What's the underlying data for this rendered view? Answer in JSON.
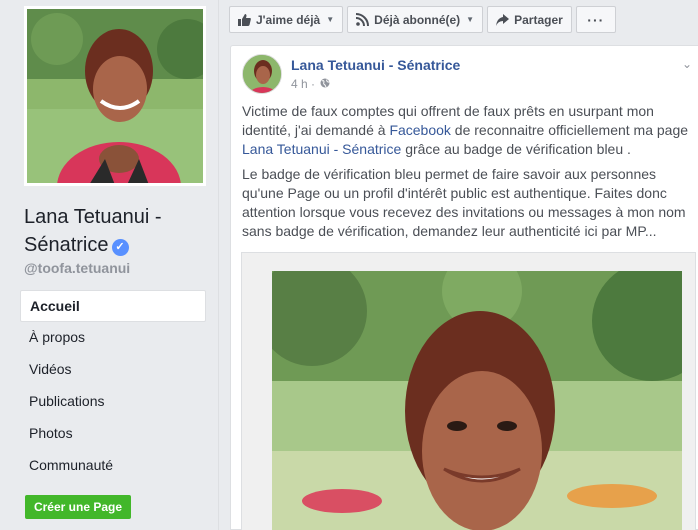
{
  "left": {
    "name_line1": "Lana Tetuanui -",
    "name_line2": "Sénatrice",
    "handle": "@toofa.tetuanui",
    "nav": [
      {
        "label": "Accueil"
      },
      {
        "label": "À propos"
      },
      {
        "label": "Vidéos"
      },
      {
        "label": "Publications"
      },
      {
        "label": "Photos"
      },
      {
        "label": "Communauté"
      }
    ],
    "create_page": "Créer une Page"
  },
  "actions": {
    "like": "J'aime déjà",
    "follow": "Déjà abonné(e)",
    "share": "Partager",
    "more": "···"
  },
  "post": {
    "author": "Lana Tetuanui - Sénatrice",
    "time": "4 h ·",
    "p1_a": "Victime de faux comptes qui offrent de faux prêts en usurpant mon identité, j'ai demandé à ",
    "p1_link1": "Facebook",
    "p1_b": " de reconnaitre officiellement ma page ",
    "p1_link2": "Lana Tetuanui - Sénatrice",
    "p1_c": " grâce au badge de vérification bleu .",
    "p2": "Le badge de vérification bleu permet de faire savoir aux personnes qu'une Page ou un profil d'intérêt public est authentique. Faites donc attention lorsque vous recevez des invitations ou messages à mon nom sans badge de vérification, demandez leur authenticité ici par MP..."
  },
  "colors": {
    "link": "#365899",
    "verified": "#5890ff",
    "create_button": "#42b72a",
    "background": "#e9ebee"
  },
  "icons": [
    "verified-badge-icon",
    "thumbs-up-icon",
    "rss-icon",
    "share-arrow-icon",
    "globe-icon",
    "chevron-down-icon"
  ]
}
